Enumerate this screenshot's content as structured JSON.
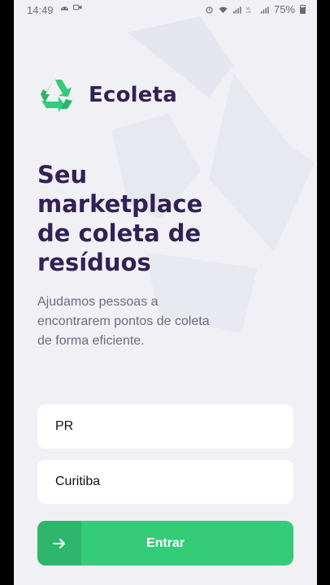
{
  "status_bar": {
    "time": "14:49",
    "battery": "75%",
    "left_icons": [
      "android-icon",
      "video-icon"
    ],
    "right_icons": [
      "alarm-icon",
      "wifi-icon",
      "signal-icon",
      "volte-icon",
      "signal-icon",
      "battery-icon"
    ]
  },
  "app": {
    "name": "Ecoleta",
    "logo_icon": "recycle-icon"
  },
  "hero": {
    "title": "Seu marketplace de coleta de resíduos",
    "description": "Ajudamos pessoas a encontrarem pontos de coleta de forma eficiente."
  },
  "form": {
    "uf_value": "PR",
    "city_value": "Curitiba",
    "submit_label": "Entrar",
    "submit_icon": "arrow-right-icon"
  },
  "colors": {
    "primary": "#34cb79",
    "title": "#322153",
    "text": "#6c6c80",
    "background": "#f0f0f5"
  }
}
